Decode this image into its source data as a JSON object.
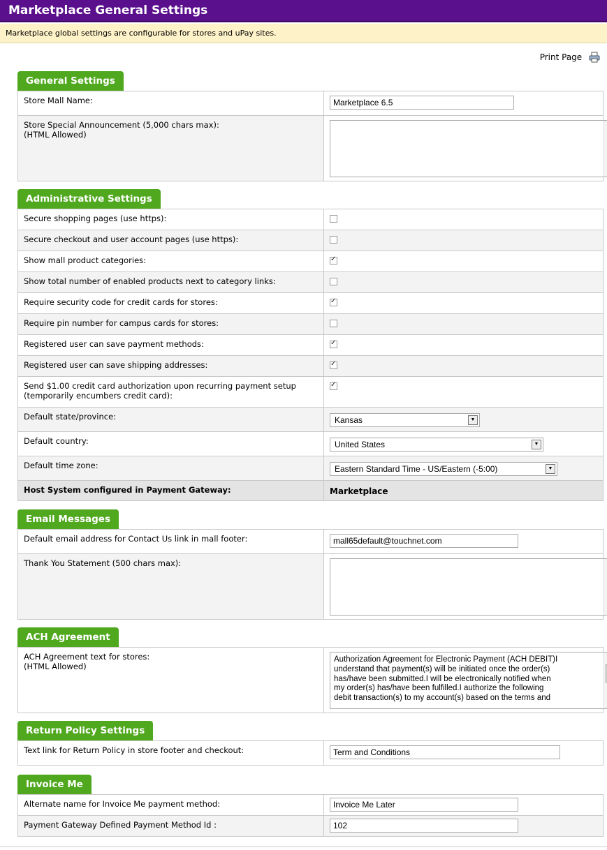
{
  "header": {
    "title": "Marketplace General Settings",
    "subtitle": "Marketplace global settings are configurable for stores and uPay sites."
  },
  "print": {
    "label": "Print Page",
    "icon": "printer-icon"
  },
  "general": {
    "tab": "General Settings",
    "store_mall_name_label": "Store Mall Name:",
    "store_mall_name_value": "Marketplace 6.5",
    "announcement_label_1": "Store Special Announcement (5,000 chars max):",
    "announcement_label_2": "(HTML Allowed)",
    "announcement_value": ""
  },
  "admin": {
    "tab": "Administrative Settings",
    "rows": [
      {
        "label": "Secure shopping pages (use https):",
        "checked": false
      },
      {
        "label": "Secure checkout and user account pages (use https):",
        "checked": false
      },
      {
        "label": "Show mall product categories:",
        "checked": true
      },
      {
        "label": "Show total number of enabled products next to category links:",
        "checked": false
      },
      {
        "label": "Require security code for credit cards for stores:",
        "checked": true
      },
      {
        "label": "Require pin number for campus cards for stores:",
        "checked": false
      },
      {
        "label": "Registered user can save payment methods:",
        "checked": true
      },
      {
        "label": "Registered user can save shipping addresses:",
        "checked": true
      },
      {
        "label": "Send $1.00 credit card authorization upon recurring payment setup",
        "label2": "(temporarily encumbers credit card):",
        "checked": true
      }
    ],
    "state_label": "Default state/province:",
    "state_value": "Kansas",
    "country_label": "Default country:",
    "country_value": "United States",
    "tz_label": "Default time zone:",
    "tz_value": "Eastern Standard Time - US/Eastern (-5:00)",
    "host_label": "Host System configured in Payment Gateway:",
    "host_value": "Marketplace"
  },
  "email": {
    "tab": "Email Messages",
    "contact_label": "Default email address for Contact Us link in mall footer:",
    "contact_value": "mall65default@touchnet.com",
    "thanks_label": "Thank You Statement (500 chars max):",
    "thanks_value": ""
  },
  "ach": {
    "tab": "ACH Agreement",
    "label_1": "ACH Agreement text for stores:",
    "label_2": "(HTML Allowed)",
    "lines": [
      "Authorization Agreement for Electronic Payment (ACH DEBIT)I",
      "understand that payment(s) will be initiated once the order(s)",
      "has/have been submitted.I will be electronically notified when",
      "my order(s) has/have been fulfilled.I authorize the following",
      "debit transaction(s) to my account(s) based on the terms and"
    ]
  },
  "return_policy": {
    "tab": "Return Policy Settings",
    "label": "Text link for Return Policy in store footer and checkout:",
    "value": "Term and Conditions"
  },
  "invoice": {
    "tab": "Invoice Me",
    "alt_label": "Alternate name for Invoice Me payment method:",
    "alt_value": "Invoice Me Later",
    "pm_label": "Payment Gateway Defined Payment Method Id :",
    "pm_value": "102"
  }
}
